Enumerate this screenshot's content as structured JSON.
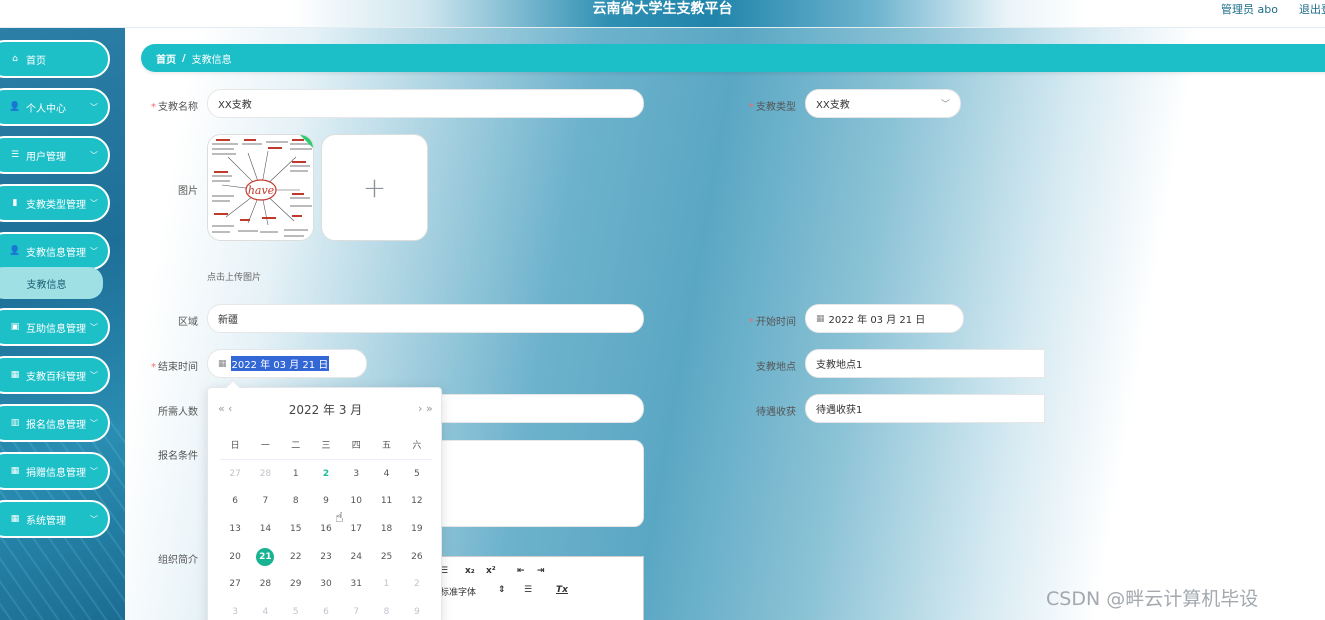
{
  "header": {
    "title": "云南省大学生支教平台",
    "user": "管理员 abo",
    "logout": "退出登录"
  },
  "sidebar": {
    "items": [
      {
        "icon": "⌂",
        "icon_name": "home-icon",
        "label": "首页",
        "has_chevron": false
      },
      {
        "icon": "👤",
        "icon_name": "user-icon",
        "label": "个人中心",
        "has_chevron": true
      },
      {
        "icon": "☰",
        "icon_name": "list-icon",
        "label": "用户管理",
        "has_chevron": true
      },
      {
        "icon": "▮",
        "icon_name": "chart-icon",
        "label": "支教类型管理",
        "has_chevron": true
      },
      {
        "icon": "👤",
        "icon_name": "user-icon",
        "label": "支教信息管理",
        "has_chevron": true
      },
      {
        "icon": "▣",
        "icon_name": "clipboard-icon",
        "label": "互助信息管理",
        "has_chevron": true
      },
      {
        "icon": "▦",
        "icon_name": "grid-icon",
        "label": "支教百科管理",
        "has_chevron": true
      },
      {
        "icon": "▥",
        "icon_name": "bar-chart-icon",
        "label": "报名信息管理",
        "has_chevron": true
      },
      {
        "icon": "▦",
        "icon_name": "grid-icon",
        "label": "捐赠信息管理",
        "has_chevron": true
      },
      {
        "icon": "▦",
        "icon_name": "grid-icon",
        "label": "系统管理",
        "has_chevron": true
      }
    ],
    "chevron": "﹀",
    "active_submenu": "支教信息"
  },
  "breadcrumb": {
    "home": "首页",
    "sep": "/",
    "current": "支教信息"
  },
  "form": {
    "name_label": "支教名称",
    "name_value": "XX支教",
    "type_label": "支教类型",
    "type_value": "XX支教",
    "image_label": "图片",
    "upload_tip": "点击上传图片",
    "upload_plus": "+",
    "thumb_center": "have",
    "region_label": "区域",
    "region_value": "新疆",
    "start_label": "开始时间",
    "start_value": "2022 年 03 月 21 日",
    "end_label": "结束时间",
    "end_value": "2022 年 03 月 21 日",
    "place_label": "支教地点",
    "place_value": "支教地点1",
    "people_label": "所需人数",
    "benefit_label": "待遇收获",
    "benefit_value": "待遇收获1",
    "condition_label": "报名条件",
    "intro_label": "组织简介"
  },
  "editor": {
    "sub": "x₂",
    "sup": "x²",
    "indent": "⇤",
    "outdent": "⇥",
    "font": "标准字体",
    "font_arrow": "⇕",
    "align": "☰",
    "clear": "Tx"
  },
  "picker": {
    "prev_year": "«",
    "prev_month": "‹",
    "next_month": "›",
    "next_year": "»",
    "title": "2022 年  3 月",
    "weekdays": [
      "日",
      "一",
      "二",
      "三",
      "四",
      "五",
      "六"
    ],
    "weeks": [
      [
        "27",
        "28",
        "1",
        "2",
        "3",
        "4",
        "5"
      ],
      [
        "6",
        "7",
        "8",
        "9",
        "10",
        "11",
        "12"
      ],
      [
        "13",
        "14",
        "15",
        "16",
        "17",
        "18",
        "19"
      ],
      [
        "20",
        "21",
        "22",
        "23",
        "24",
        "25",
        "26"
      ],
      [
        "27",
        "28",
        "29",
        "30",
        "31",
        "1",
        "2"
      ],
      [
        "3",
        "4",
        "5",
        "6",
        "7",
        "8",
        "9"
      ]
    ],
    "selected": "21",
    "today": "2"
  },
  "watermark": "CSDN @畔云计算机毕设",
  "colors": {
    "accent": "#1cbfc8",
    "selected": "#19b394",
    "required": "#f56c6c"
  }
}
